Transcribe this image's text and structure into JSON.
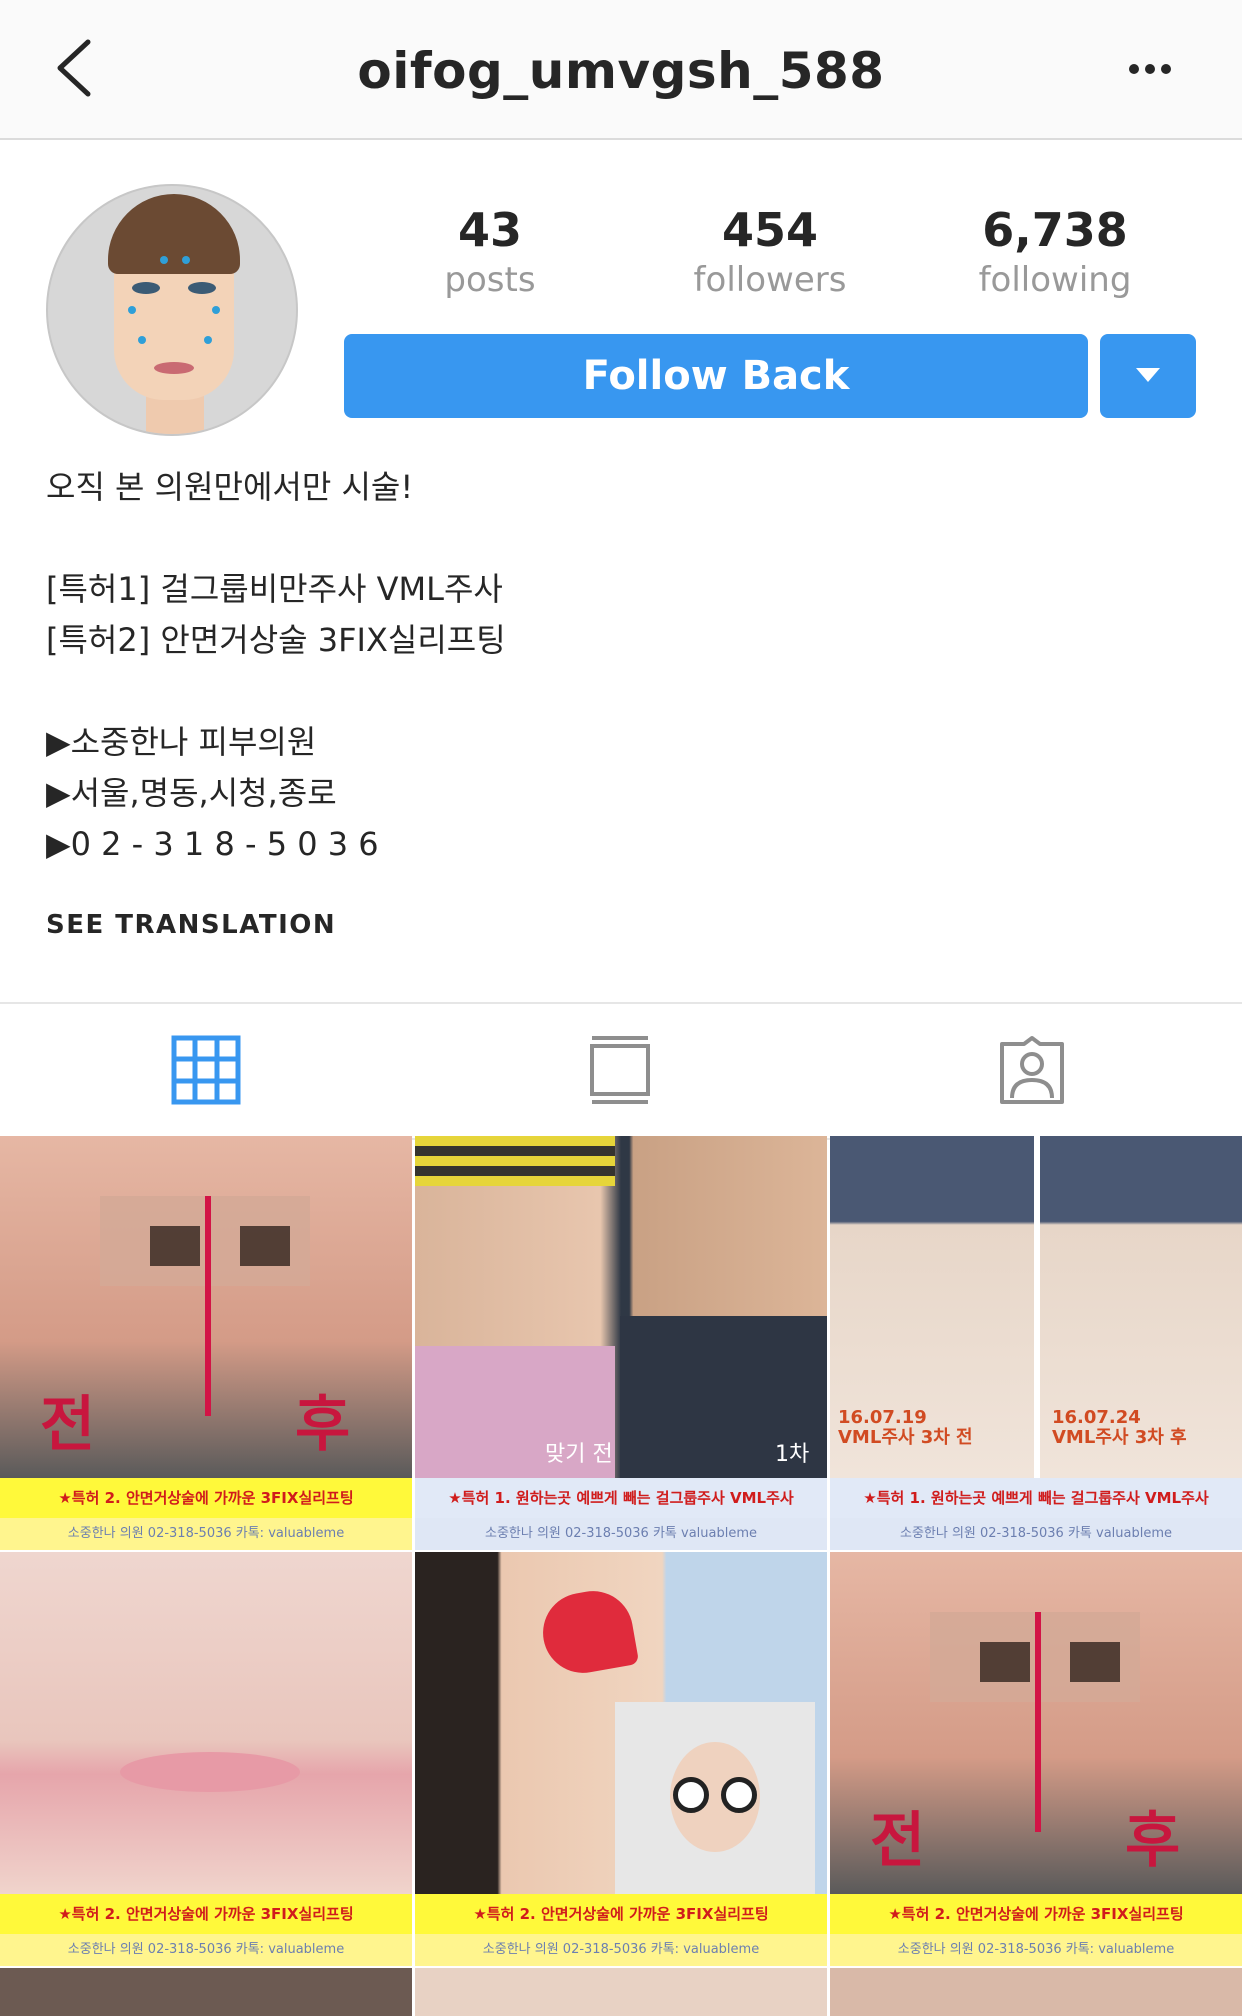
{
  "header": {
    "username": "oifog_umvgsh_588",
    "back_icon": "chevron-left-icon",
    "more_icon": "more-horizontal-icon"
  },
  "profile": {
    "stats": [
      {
        "value": "43",
        "label": "posts"
      },
      {
        "value": "454",
        "label": "followers"
      },
      {
        "value": "6,738",
        "label": "following"
      }
    ],
    "follow_label": "Follow Back",
    "bio": "오직 본 의원만에서만 시술!\n\n[특허1] 걸그룹비만주사 VML주사\n[특허2] 안면거상술 3FIX실리프팅\n\n▶소중한나 피부의원\n▶서울,명동,시청,종로\n▶0 2 - 3 1 8 - 5 0 3 6",
    "see_translation": "SEE TRANSLATION"
  },
  "tabs": [
    "grid-icon",
    "feed-icon",
    "tagged-icon"
  ],
  "colors": {
    "accent": "#3897f0",
    "text": "#262626",
    "muted": "#999999"
  },
  "posts": [
    {
      "cap1": "★특허 2.  안면거상술에 가까운 3FIX실리프팅",
      "cap2": "소중한나 의원      02-318-5036      카톡: valuableme",
      "overlay_left": "전",
      "overlay_right": "후"
    },
    {
      "cap1": "★특허 1.  원하는곳 예쁘게 빼는 걸그룹주사 VML주사",
      "cap2": "소중한나 의원      02-318-5036      카톡 valuableme",
      "overlay_left": "맞기 전",
      "overlay_right": "1차"
    },
    {
      "cap1": "★특허 1.  원하는곳 예쁘게 빼는 걸그룹주사 VML주사",
      "cap2": "소중한나 의원      02-318-5036      카톡 valuableme",
      "overlay_left": "16.07.19\nVML주사 3차 전",
      "overlay_right": "16.07.24\nVML주사 3차 후"
    },
    {
      "cap1": "★특허 2.  안면거상술에 가까운 3FIX실리프팅",
      "cap2": "소중한나 의원      02-318-5036      카톡: valuableme"
    },
    {
      "cap1": "★특허 2.  안면거상술에 가까운 3FIX실리프팅",
      "cap2": "소중한나 의원      02-318-5036      카톡: valuableme"
    },
    {
      "cap1": "★특허 2.  안면거상술에 가까운 3FIX실리프팅",
      "cap2": "소중한나 의원      02-318-5036      카톡: valuableme",
      "overlay_left": "전",
      "overlay_right": "후"
    }
  ]
}
